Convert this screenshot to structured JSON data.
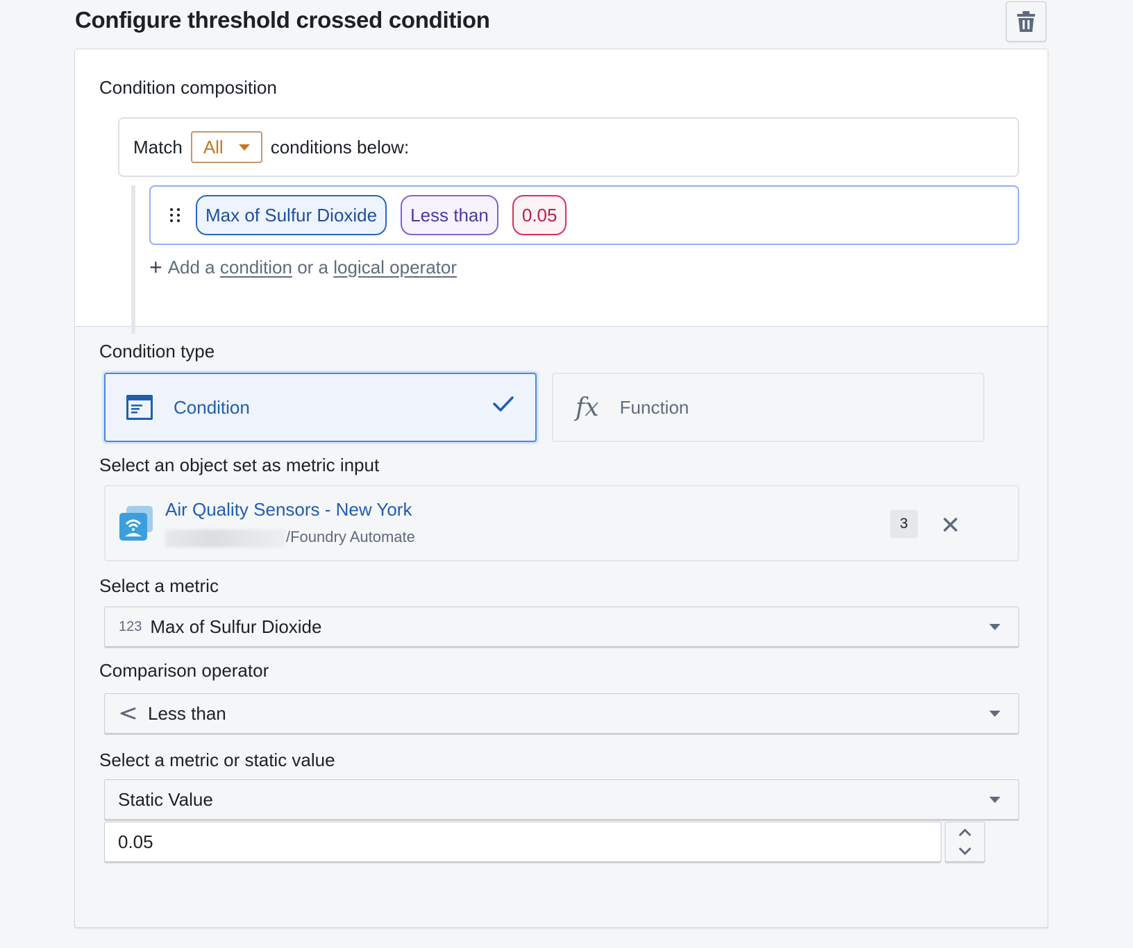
{
  "header": {
    "title": "Configure threshold crossed condition",
    "delete_icon": "trash-icon"
  },
  "composition": {
    "label": "Condition composition",
    "match_prefix": "Match",
    "match_value": "All",
    "match_suffix": "conditions below:",
    "condition": {
      "drag_icon": "drag-handle-icon",
      "metric": "Max of Sulfur Dioxide",
      "operator": "Less than",
      "value": "0.05"
    },
    "add_row": {
      "prefix": "Add a",
      "link_condition": "condition",
      "middle": "or a",
      "link_operator": "logical operator"
    }
  },
  "condition_type": {
    "label": "Condition type",
    "options": [
      {
        "label": "Condition",
        "icon": "condition-icon",
        "selected": true
      },
      {
        "label": "Function",
        "icon": "function-fx-icon",
        "selected": false
      }
    ]
  },
  "object_set": {
    "label": "Select an object set as metric input",
    "name": "Air Quality Sensors - New York",
    "path": "/Foundry Automate",
    "count": "3",
    "icon": "sensor-object-icon"
  },
  "metric": {
    "label": "Select a metric",
    "type_prefix": "123",
    "value": "Max of Sulfur Dioxide"
  },
  "operator": {
    "label": "Comparison operator",
    "symbol": "<",
    "value": "Less than"
  },
  "comparison_value": {
    "label": "Select a metric or static value",
    "mode": "Static Value",
    "value": "0.05"
  },
  "colors": {
    "accent_blue": "#2965c2",
    "operator_purple": "#8060d8",
    "value_red": "#d6305a",
    "match_orange": "#c87619"
  }
}
